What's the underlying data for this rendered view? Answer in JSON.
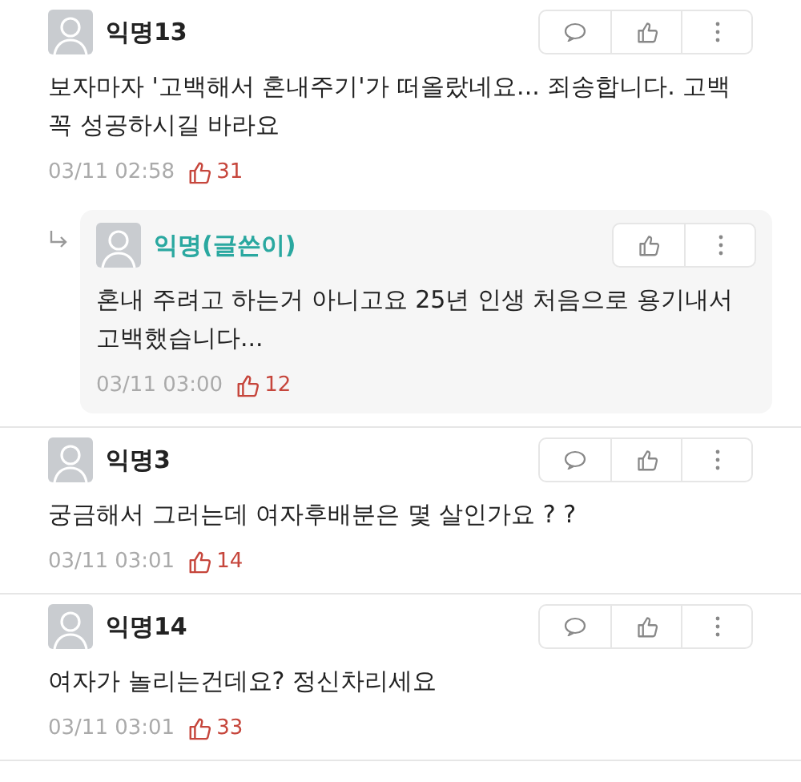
{
  "comments": [
    {
      "kind": "comment",
      "author": "익명13",
      "author_is_op": false,
      "text": "보자마자 '고백해서 혼내주기'가 떠올랐네요... 죄송합니다. 고백 꼭 성공하시길 바라요",
      "time": "03/11 02:58",
      "likes": "31"
    },
    {
      "kind": "reply",
      "author": "익명(글쓴이)",
      "author_is_op": true,
      "text": "혼내 주려고 하는거 아니고요 25년 인생 처음으로 용기내서 고백했습니다...",
      "time": "03/11 03:00",
      "likes": "12"
    },
    {
      "kind": "comment",
      "author": "익명3",
      "author_is_op": false,
      "text": "궁금해서 그러는데 여자후배분은 몇 살인가요 ? ?",
      "time": "03/11 03:01",
      "likes": "14"
    },
    {
      "kind": "comment",
      "author": "익명14",
      "author_is_op": false,
      "text": "여자가 놀리는건데요? 정신차리세요",
      "time": "03/11 03:01",
      "likes": "33"
    }
  ]
}
